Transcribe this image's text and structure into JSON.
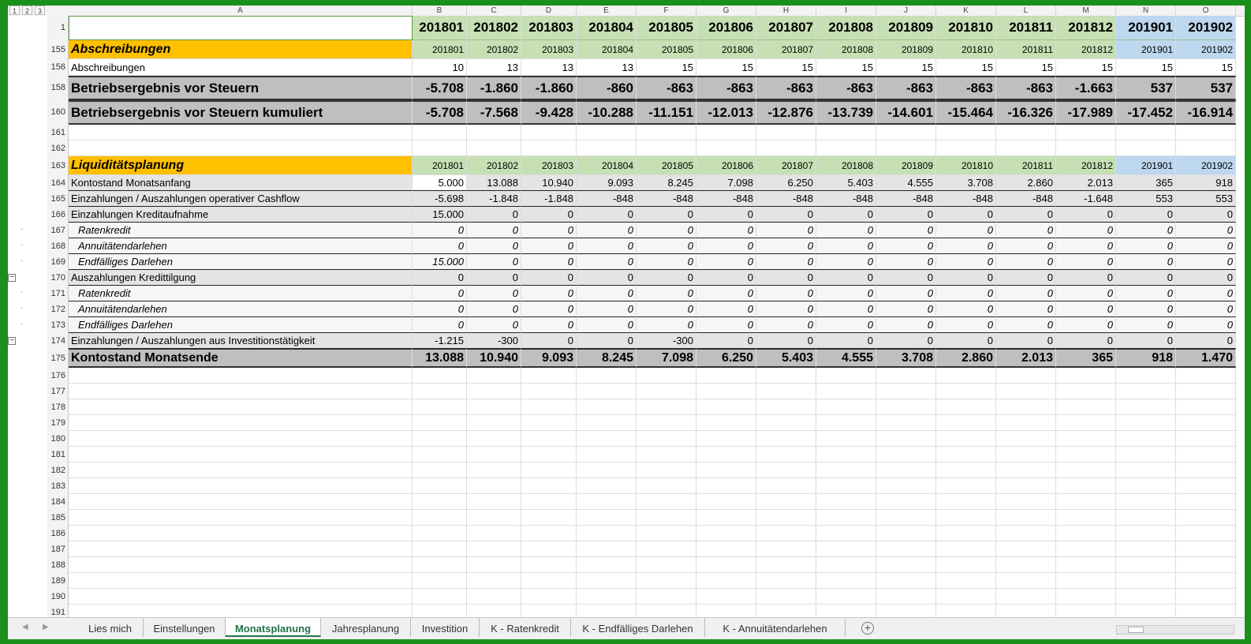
{
  "outline_levels": [
    "1",
    "2",
    "3"
  ],
  "col_letters": [
    "A",
    "B",
    "C",
    "D",
    "E",
    "F",
    "G",
    "H",
    "I",
    "J",
    "K",
    "L",
    "M",
    "N",
    "O"
  ],
  "periods": [
    "201801",
    "201802",
    "201803",
    "201804",
    "201805",
    "201806",
    "201807",
    "201808",
    "201809",
    "201810",
    "201811",
    "201812",
    "201901",
    "201902"
  ],
  "rows": [
    {
      "num": "1",
      "type": "hdr1",
      "label": "",
      "values": [
        "201801",
        "201802",
        "201803",
        "201804",
        "201805",
        "201806",
        "201807",
        "201808",
        "201809",
        "201810",
        "201811",
        "201812",
        "201901",
        "201902"
      ]
    },
    {
      "num": "155",
      "type": "sec",
      "label": "Abschreibungen",
      "values": [
        "201801",
        "201802",
        "201803",
        "201804",
        "201805",
        "201806",
        "201807",
        "201808",
        "201809",
        "201810",
        "201811",
        "201812",
        "201901",
        "201902"
      ]
    },
    {
      "num": "156",
      "type": "white",
      "label": "Abschreibungen",
      "values": [
        "10",
        "13",
        "13",
        "13",
        "15",
        "15",
        "15",
        "15",
        "15",
        "15",
        "15",
        "15",
        "15",
        "15"
      ]
    },
    {
      "num": "158",
      "type": "big",
      "label": "Betriebsergebnis vor Steuern",
      "values": [
        "-5.708",
        "-1.860",
        "-1.860",
        "-860",
        "-863",
        "-863",
        "-863",
        "-863",
        "-863",
        "-863",
        "-863",
        "-1.663",
        "537",
        "537"
      ]
    },
    {
      "num": "160",
      "type": "big",
      "label": "Betriebsergebnis vor Steuern kumuliert",
      "values": [
        "-5.708",
        "-7.568",
        "-9.428",
        "-10.288",
        "-11.151",
        "-12.013",
        "-12.876",
        "-13.739",
        "-14.601",
        "-15.464",
        "-16.326",
        "-17.989",
        "-17.452",
        "-16.914"
      ]
    },
    {
      "num": "161",
      "type": "empty",
      "label": "",
      "values": []
    },
    {
      "num": "162",
      "type": "empty",
      "label": "",
      "values": []
    },
    {
      "num": "163",
      "type": "sec",
      "label": "Liquiditätsplanung",
      "values": [
        "201801",
        "201802",
        "201803",
        "201804",
        "201805",
        "201806",
        "201807",
        "201808",
        "201809",
        "201810",
        "201811",
        "201812",
        "201901",
        "201902"
      ]
    },
    {
      "num": "164",
      "type": "grey",
      "label": "Kontostand Monatsanfang",
      "values": [
        "5.000",
        "13.088",
        "10.940",
        "9.093",
        "8.245",
        "7.098",
        "6.250",
        "5.403",
        "4.555",
        "3.708",
        "2.860",
        "2.013",
        "365",
        "918"
      ]
    },
    {
      "num": "165",
      "type": "grey",
      "label": "Einzahlungen / Auszahlungen operativer Cashflow",
      "values": [
        "-5.698",
        "-1.848",
        "-1.848",
        "-848",
        "-848",
        "-848",
        "-848",
        "-848",
        "-848",
        "-848",
        "-848",
        "-1.648",
        "553",
        "553"
      ]
    },
    {
      "num": "166",
      "type": "grey",
      "label": "Einzahlungen Kreditaufnahme",
      "values": [
        "15.000",
        "0",
        "0",
        "0",
        "0",
        "0",
        "0",
        "0",
        "0",
        "0",
        "0",
        "0",
        "0",
        "0"
      ]
    },
    {
      "num": "167",
      "type": "light ital",
      "label": "Ratenkredit",
      "values": [
        "0",
        "0",
        "0",
        "0",
        "0",
        "0",
        "0",
        "0",
        "0",
        "0",
        "0",
        "0",
        "0",
        "0"
      ]
    },
    {
      "num": "168",
      "type": "light ital",
      "label": "Annuitätendarlehen",
      "values": [
        "0",
        "0",
        "0",
        "0",
        "0",
        "0",
        "0",
        "0",
        "0",
        "0",
        "0",
        "0",
        "0",
        "0"
      ]
    },
    {
      "num": "169",
      "type": "light ital",
      "label": "Endfälliges Darlehen",
      "values": [
        "15.000",
        "0",
        "0",
        "0",
        "0",
        "0",
        "0",
        "0",
        "0",
        "0",
        "0",
        "0",
        "0",
        "0"
      ]
    },
    {
      "num": "170",
      "type": "grey",
      "label": "Auszahlungen Kredittilgung",
      "values": [
        "0",
        "0",
        "0",
        "0",
        "0",
        "0",
        "0",
        "0",
        "0",
        "0",
        "0",
        "0",
        "0",
        "0"
      ]
    },
    {
      "num": "171",
      "type": "light ital",
      "label": "Ratenkredit",
      "values": [
        "0",
        "0",
        "0",
        "0",
        "0",
        "0",
        "0",
        "0",
        "0",
        "0",
        "0",
        "0",
        "0",
        "0"
      ]
    },
    {
      "num": "172",
      "type": "light ital",
      "label": "Annuitätendarlehen",
      "values": [
        "0",
        "0",
        "0",
        "0",
        "0",
        "0",
        "0",
        "0",
        "0",
        "0",
        "0",
        "0",
        "0",
        "0"
      ]
    },
    {
      "num": "173",
      "type": "light ital",
      "label": "Endfälliges Darlehen",
      "values": [
        "0",
        "0",
        "0",
        "0",
        "0",
        "0",
        "0",
        "0",
        "0",
        "0",
        "0",
        "0",
        "0",
        "0"
      ]
    },
    {
      "num": "174",
      "type": "grey",
      "label": "Einzahlungen / Auszahlungen aus Investitionstätigkeit",
      "values": [
        "-1.215",
        "-300",
        "0",
        "0",
        "-300",
        "0",
        "0",
        "0",
        "0",
        "0",
        "0",
        "0",
        "0",
        "0"
      ]
    },
    {
      "num": "175",
      "type": "total",
      "label": "Kontostand Monatsende",
      "values": [
        "13.088",
        "10.940",
        "9.093",
        "8.245",
        "7.098",
        "6.250",
        "5.403",
        "4.555",
        "3.708",
        "2.860",
        "2.013",
        "365",
        "918",
        "1.470"
      ]
    },
    {
      "num": "176",
      "type": "empty",
      "label": "",
      "values": []
    },
    {
      "num": "177",
      "type": "empty",
      "label": "",
      "values": []
    },
    {
      "num": "178",
      "type": "empty",
      "label": "",
      "values": []
    },
    {
      "num": "179",
      "type": "empty",
      "label": "",
      "values": []
    },
    {
      "num": "180",
      "type": "empty",
      "label": "",
      "values": []
    },
    {
      "num": "181",
      "type": "empty",
      "label": "",
      "values": []
    },
    {
      "num": "182",
      "type": "empty",
      "label": "",
      "values": []
    },
    {
      "num": "183",
      "type": "empty",
      "label": "",
      "values": []
    },
    {
      "num": "184",
      "type": "empty",
      "label": "",
      "values": []
    },
    {
      "num": "185",
      "type": "empty",
      "label": "",
      "values": []
    },
    {
      "num": "186",
      "type": "empty",
      "label": "",
      "values": []
    },
    {
      "num": "187",
      "type": "empty",
      "label": "",
      "values": []
    },
    {
      "num": "188",
      "type": "empty",
      "label": "",
      "values": []
    },
    {
      "num": "189",
      "type": "empty",
      "label": "",
      "values": []
    },
    {
      "num": "190",
      "type": "empty",
      "label": "",
      "values": []
    },
    {
      "num": "191",
      "type": "empty",
      "label": "",
      "values": []
    }
  ],
  "sheet_tabs": [
    "Lies mich",
    "Einstellungen",
    "Monatsplanung",
    "Jahresplanung",
    "Investition",
    "K - Ratenkredit",
    "K - Endfälliges Darlehen",
    "K - Annuitätendarlehen"
  ],
  "active_tab": "Monatsplanung",
  "colors": {
    "section_label": "#ffc000",
    "period_green": "#c6e0b4",
    "period_blue": "#bdd7ee",
    "total_grey": "#bfbfbf",
    "active_tab": "#217346",
    "frame_green": "#1a8f1a"
  }
}
